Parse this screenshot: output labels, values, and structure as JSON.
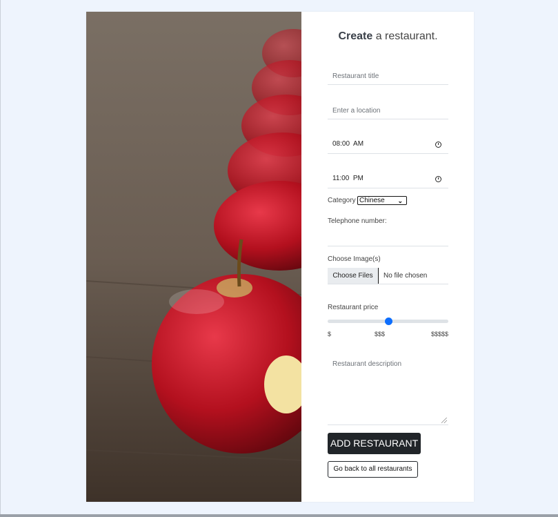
{
  "form": {
    "title_bold": "Create",
    "title_rest": " a restaurant.",
    "restaurant_title_placeholder": "Restaurant title",
    "location_placeholder": "Enter a location",
    "open_time": "08:00  AM",
    "close_time": "11:00  PM",
    "category_label": "Category",
    "category_selected": "Chinese",
    "telephone_label": "Telephone number:",
    "images_label": "Choose Image(s)",
    "choose_files_label": "Choose Files",
    "no_file_text": "No file chosen",
    "price_label": "Restaurant price",
    "price_ticks": [
      "$",
      "$$$",
      "$$$$$"
    ],
    "price_value_fraction": 0.5,
    "description_placeholder": "Restaurant description",
    "add_button": "ADD RESTAURANT",
    "back_button": "Go back to all restaurants"
  },
  "colors": {
    "page_background": "#eef4fd",
    "primary_button": "#212529",
    "slider_accent": "#0d6efd"
  },
  "icons": [
    "clock-icon",
    "chevron-down-icon",
    "resize-handle-icon"
  ]
}
